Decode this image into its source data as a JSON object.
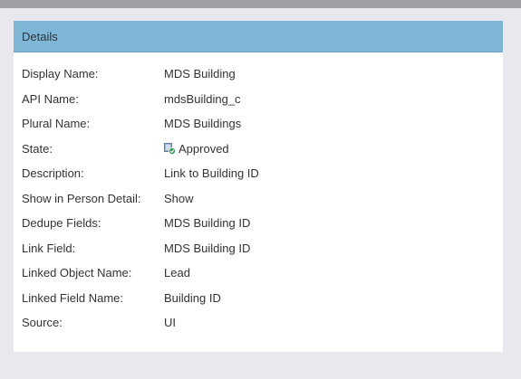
{
  "panel": {
    "title": "Details"
  },
  "fields": [
    {
      "label": "Display Name:",
      "value": "MDS Building"
    },
    {
      "label": "API Name:",
      "value": "mdsBuilding_c"
    },
    {
      "label": "Plural Name:",
      "value": "MDS Buildings"
    },
    {
      "label": "State:",
      "value": "Approved",
      "icon": "approved-state-icon"
    },
    {
      "label": "Description:",
      "value": "Link to Building ID"
    },
    {
      "label": "Show in Person Detail:",
      "value": "Show"
    },
    {
      "label": "Dedupe Fields:",
      "value": "MDS Building ID"
    },
    {
      "label": "Link Field:",
      "value": "MDS Building ID"
    },
    {
      "label": "Linked Object Name:",
      "value": "Lead"
    },
    {
      "label": "Linked Field Name:",
      "value": "Building ID"
    },
    {
      "label": "Source:",
      "value": "UI"
    }
  ],
  "colors": {
    "header_bg": "#7fb6d6",
    "page_bg": "#e8e8ee",
    "top_bar": "#9e9ea3"
  }
}
